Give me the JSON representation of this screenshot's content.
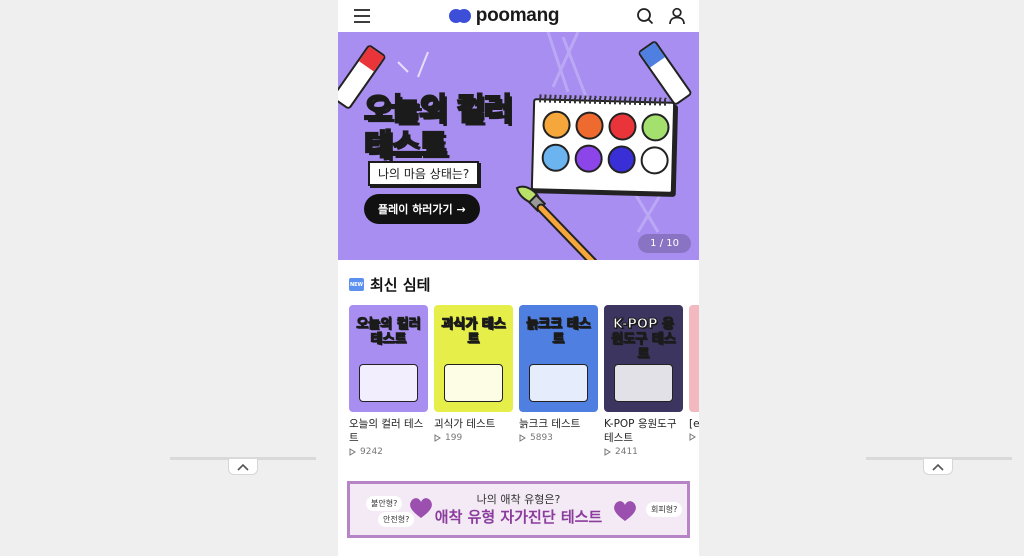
{
  "header": {
    "logo_text": "poomang",
    "menu_icon": "hamburger-icon",
    "search_icon": "search-icon",
    "profile_icon": "user-icon"
  },
  "banner": {
    "title_line1": "오늘의 컬러",
    "title_line2": "테스트",
    "subtitle": "나의 마음 상태는?",
    "cta_label": "플레이 하러가기 →",
    "counter": "1 / 10",
    "background_color": "#a88ef0",
    "palette_colors": [
      "#f5a73b",
      "#ef6a2f",
      "#e9353a",
      "#a4e06d",
      "#6cb4f0",
      "#8c45e9",
      "#3a2fd6",
      "#ffffff"
    ]
  },
  "latest_section": {
    "title": "최신 심테",
    "badge_text": "NEW",
    "items": [
      {
        "title": "오늘의 컬러 테스트",
        "plays": "9242",
        "thumb_title": "오늘의 컬러 테스트",
        "thumb_color": "#a88ef0"
      },
      {
        "title": "괴식가 테스트",
        "plays": "199",
        "thumb_title": "괴식가 테스트",
        "thumb_color": "#e6ee4a"
      },
      {
        "title": "늙크크 테스트",
        "plays": "5893",
        "thumb_title": "늙크크 테스트",
        "thumb_color": "#4f7fe0"
      },
      {
        "title": "K-POP 응원도구 테스트",
        "plays": "2411",
        "thumb_title": "K-POP 응원도구 테스트",
        "thumb_color": "#3b3560"
      },
      {
        "title": "[e",
        "plays": "",
        "thumb_title": "",
        "thumb_color": "#f2b9c0"
      }
    ]
  },
  "ad": {
    "top_text": "나의 애착 유형은?",
    "main_text": "애착 유형 자가진단 테스트",
    "chips": [
      "불안형?",
      "안전형?",
      "회피형?"
    ]
  }
}
